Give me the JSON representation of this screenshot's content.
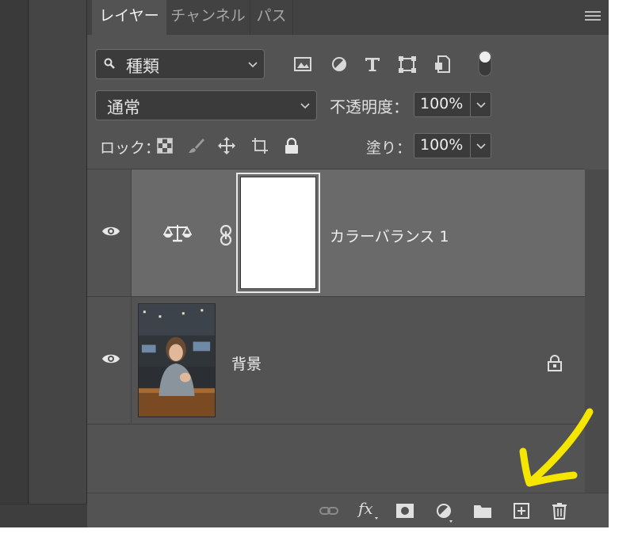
{
  "tabs": [
    {
      "label": "レイヤー",
      "active": true
    },
    {
      "label": "チャンネル",
      "active": false
    },
    {
      "label": "パス",
      "active": false
    }
  ],
  "filter": {
    "label": "種類"
  },
  "filter_icons": [
    "image-filter-icon",
    "adjustment-filter-icon",
    "type-filter-icon",
    "shape-filter-icon",
    "smart-object-filter-icon",
    "filter-toggle-icon"
  ],
  "blend": {
    "mode": "通常"
  },
  "opacity": {
    "label": "不透明度：",
    "value": "100%"
  },
  "lock": {
    "label": "ロック："
  },
  "fill": {
    "label": "塗り：",
    "value": "100%"
  },
  "layers": [
    {
      "name": "カラーバランス 1",
      "type": "adjustment",
      "visible": true,
      "selected": true
    },
    {
      "name": "背景",
      "type": "background",
      "visible": true,
      "locked": true
    }
  ],
  "colors": {
    "panel_bg": "#535353",
    "selected_row": "#6a6a6a",
    "tab_bar": "#424242",
    "arrow": "#f5e600"
  }
}
